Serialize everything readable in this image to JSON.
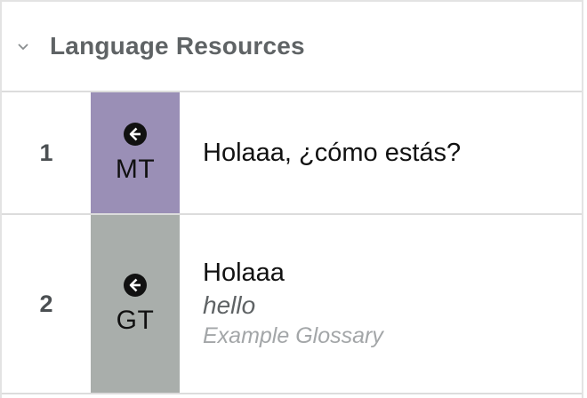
{
  "section": {
    "title": "Language Resources",
    "collapse_icon": "chevron-down-icon"
  },
  "rows": [
    {
      "index": "1",
      "badge_icon": "arrow-circle-left-icon",
      "badge_label": "MT",
      "badge_color": "#9a8fb6",
      "text": "Holaaa, ¿cómo estás?"
    },
    {
      "index": "2",
      "badge_icon": "arrow-circle-left-icon",
      "badge_label": "GT",
      "badge_color": "#a9aeab",
      "text": "Holaaa",
      "term": "hello",
      "glossary": "Example Glossary"
    }
  ]
}
